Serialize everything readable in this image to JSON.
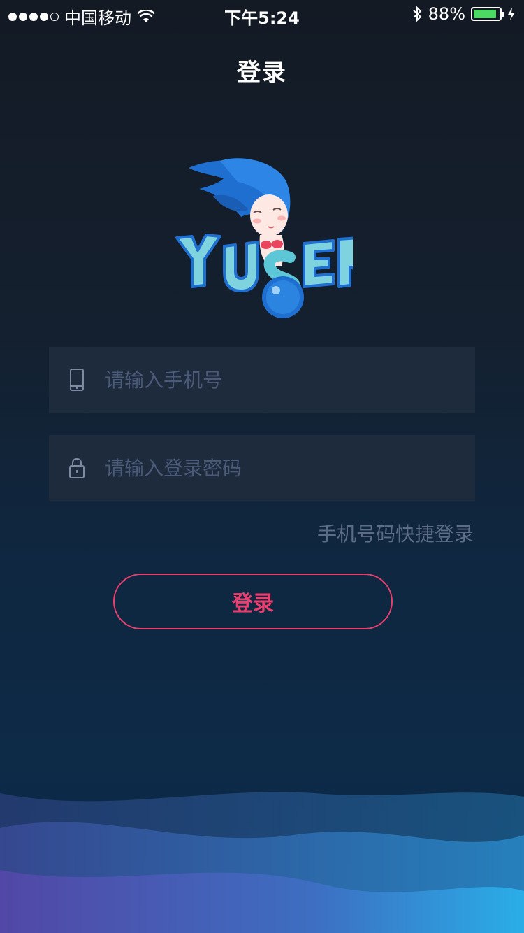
{
  "status": {
    "carrier": "中国移动",
    "time": "下午5:24",
    "battery": "88%",
    "battery_level": 0.88
  },
  "nav": {
    "title": "登录"
  },
  "form": {
    "phone_placeholder": "请输入手机号",
    "password_placeholder": "请输入登录密码",
    "quick_login": "手机号码快捷登录",
    "login_button": "登录"
  },
  "colors": {
    "accent": "#e93f6e",
    "input_bg": "#1d2b3d",
    "battery_green": "#4cd964"
  }
}
